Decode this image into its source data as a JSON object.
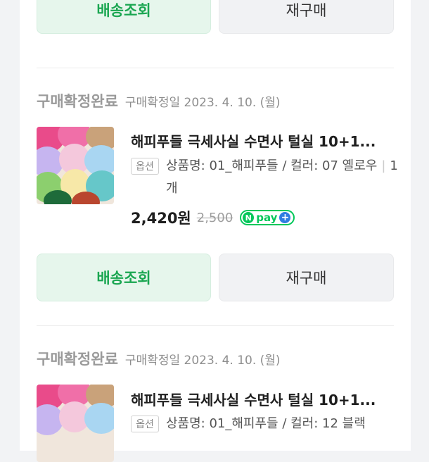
{
  "top_buttons": {
    "track_label": "배송조회",
    "rebuy_label": "재구매"
  },
  "orders": [
    {
      "status": "구매확정완료",
      "confirm_date": "구매확정일 2023. 4. 10. (월)",
      "product_name": "해피푸들 극세사실 수면사 털실 10+1...",
      "option_badge": "옵션",
      "option_text": "상품명: 01_해피푸들 / 컬러: 07 옐로우",
      "quantity": "1개",
      "price": "2,420원",
      "original_price": "2,500",
      "pay_badge": {
        "n": "N",
        "label": "pay",
        "plus": "+"
      },
      "track_label": "배송조회",
      "rebuy_label": "재구매"
    },
    {
      "status": "구매확정완료",
      "confirm_date": "구매확정일 2023. 4. 10. (월)",
      "product_name": "해피푸들 극세사실 수면사 털실 10+1...",
      "option_badge": "옵션",
      "option_text": "상품명: 01_해피푸들 / 컬러: 12 블랙"
    }
  ],
  "colors": {
    "accent_green": "#1aa651",
    "npay_green": "#03c75a",
    "plus_blue": "#2f7de1"
  }
}
